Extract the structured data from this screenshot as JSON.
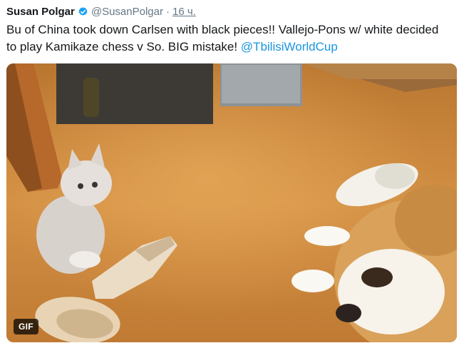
{
  "tweet": {
    "author_name": "Susan Polgar",
    "handle": "@SusanPolgar",
    "separator": "·",
    "timestamp": "16 ч.",
    "text_main": "Bu of China took down Carlsen with black pieces!! Vallejo-Pons w/ white decided to play Kamikaze chess v So. BIG mistake! ",
    "mention": "@TbilisiWorldCup",
    "verified_icon": "verified-badge-icon",
    "accent_color": "#1da1f2"
  },
  "media": {
    "badge": "GIF"
  }
}
